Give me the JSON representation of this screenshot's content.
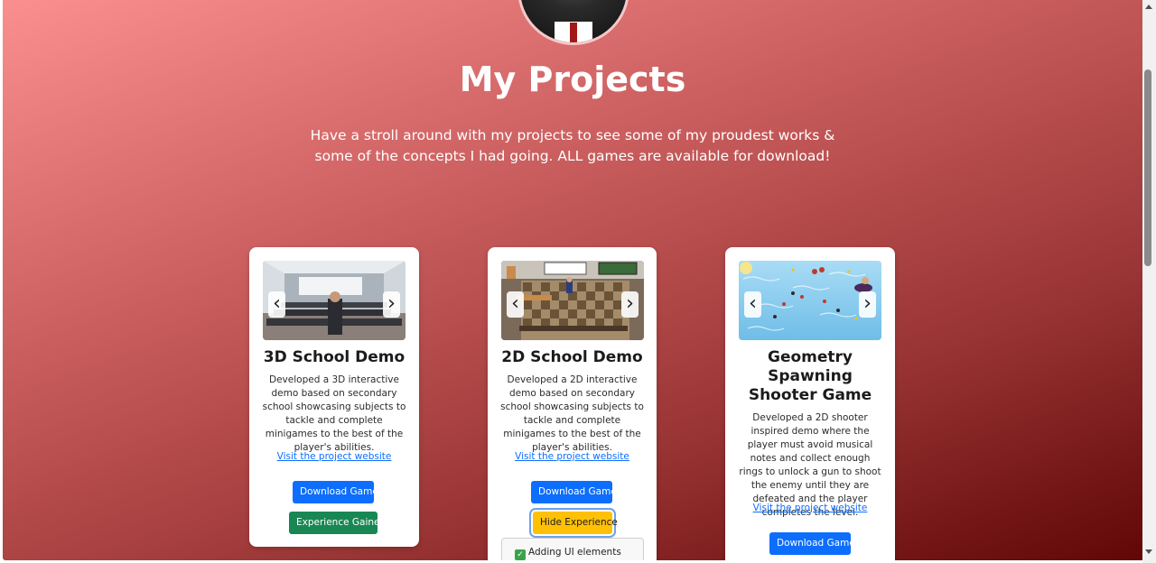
{
  "header": {
    "title": "My Projects",
    "intro": "Have a stroll around with my projects to see some of my proudest works & some of the concepts I had going. ALL games are available for download!"
  },
  "carousel": {
    "prev_glyph": "‹",
    "next_glyph": "›"
  },
  "projects": [
    {
      "title": "3D School Demo",
      "description": "Developed a 3D interactive demo based on secondary school showcasing subjects to tackle and complete minigames to the best of the player's abilities.",
      "link": "Visit the project website",
      "download": "Download Game",
      "experience": "Experience Gained"
    },
    {
      "title": "2D School Demo",
      "description": "Developed a 2D interactive demo based on secondary school showcasing subjects to tackle and complete minigames to the best of the player's abilities.",
      "link": "Visit the project website",
      "download": "Download Game",
      "experience": "Hide Experience",
      "experience_item": "Adding UI elements onto"
    },
    {
      "title": "Geometry Spawning Shooter Game",
      "description": "Developed a 2D shooter inspired demo where the player must avoid musical notes and collect enough rings to unlock a gun to shoot the enemy until they are defeated and the player completes the level.",
      "link": "Visit the project website",
      "download": "Download Game"
    }
  ],
  "colors": {
    "gradient_start": "#fb8e8e",
    "gradient_end": "#610606",
    "primary": "#0d6efd",
    "success": "#198754",
    "warning": "#ffc107"
  }
}
